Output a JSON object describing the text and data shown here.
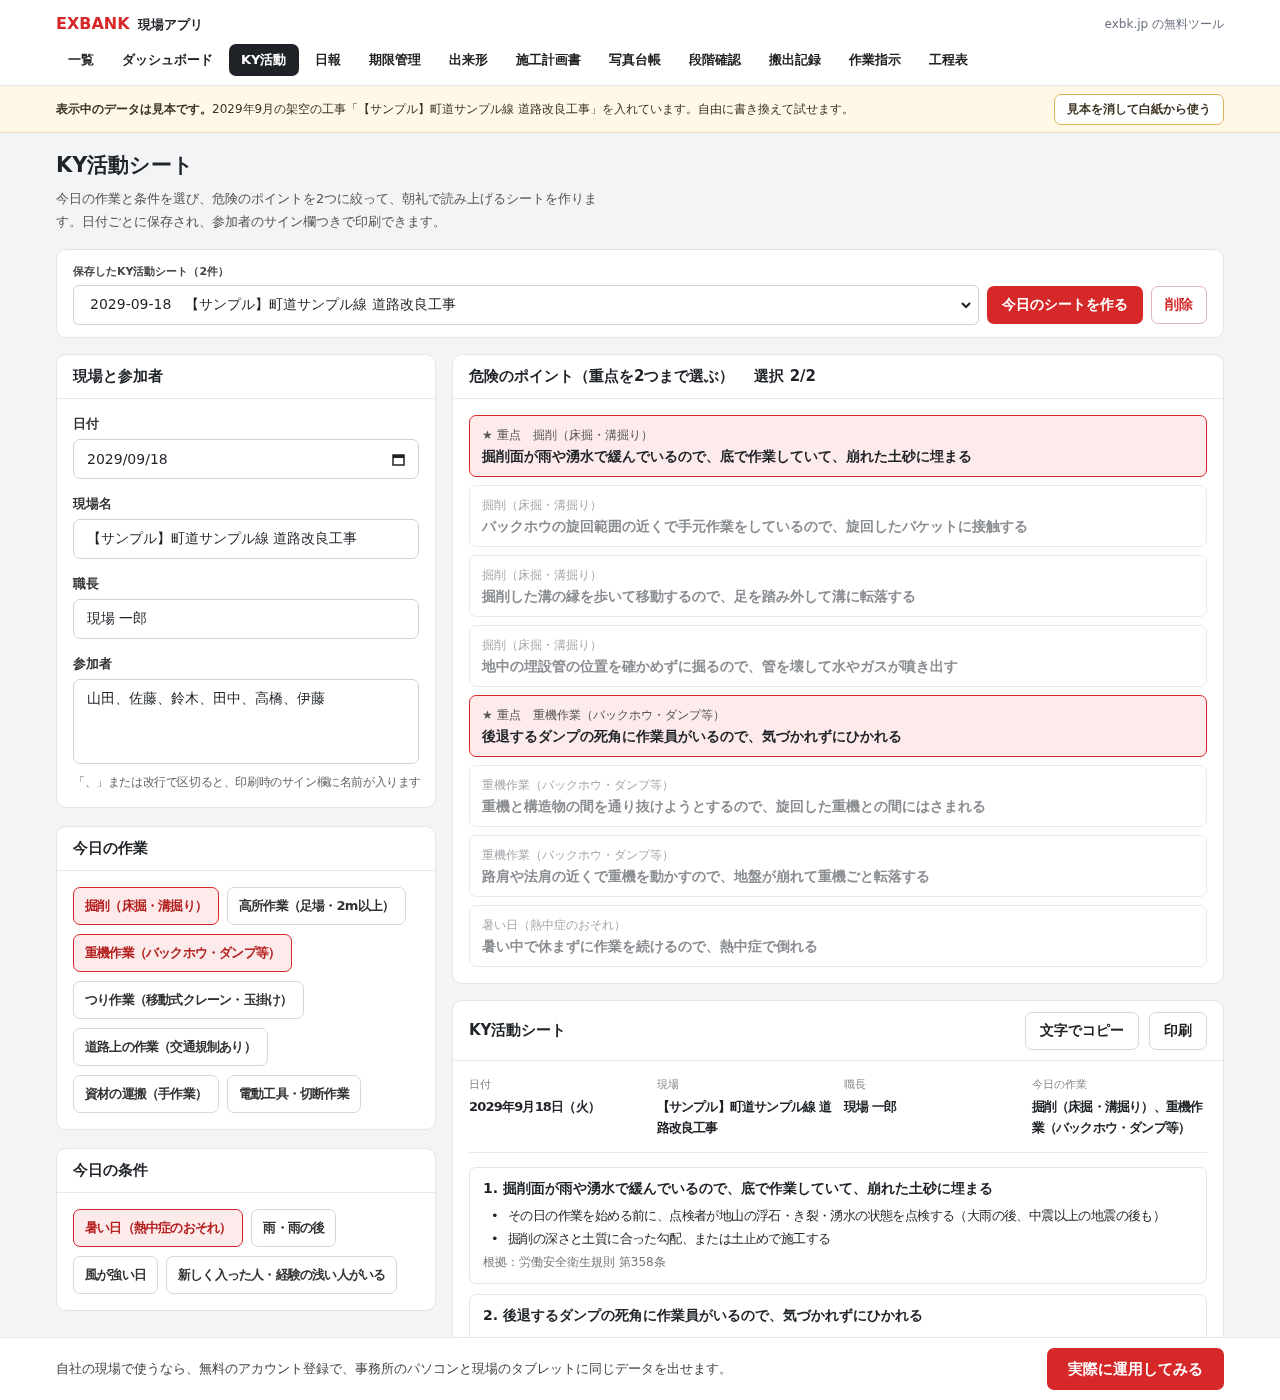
{
  "header": {
    "brand": "EXBANK",
    "app_name": "現場アプリ",
    "tagline": "exbk.jp の無料ツール"
  },
  "nav": [
    {
      "label": "一覧",
      "selected": false
    },
    {
      "label": "ダッシュボード",
      "selected": false
    },
    {
      "label": "KY活動",
      "selected": true
    },
    {
      "label": "日報",
      "selected": false
    },
    {
      "label": "期限管理",
      "selected": false
    },
    {
      "label": "出来形",
      "selected": false
    },
    {
      "label": "施工計画書",
      "selected": false
    },
    {
      "label": "写真台帳",
      "selected": false
    },
    {
      "label": "段階確認",
      "selected": false
    },
    {
      "label": "搬出記録",
      "selected": false
    },
    {
      "label": "作業指示",
      "selected": false
    },
    {
      "label": "工程表",
      "selected": false
    }
  ],
  "notice": {
    "text": "**表示中のデータは見本です。**2029年9月の架空の工事「【サンプル】町道サンプル線 道路改良工事」を入れています。自由に書き換えて試せます。",
    "button": "見本を消して白紙から使う"
  },
  "page": {
    "title": "KY活動シート",
    "description": "今日の作業と条件を選び、危険のポイントを2つに絞って、朝礼で読み上げるシートを作ります。日付ごとに保存され、参加者のサイン欄つきで印刷できます。"
  },
  "saved": {
    "label": "保存したKY活動シート（2件）",
    "selected_value": "2029-09-18　【サンプル】町道サンプル線 道路改良工事",
    "create_button": "今日のシートを作る",
    "delete_button": "削除"
  },
  "site_panel": {
    "title": "現場と参加者",
    "fields": [
      {
        "kind": "date",
        "label": "日付",
        "value": "2029/09/18"
      },
      {
        "kind": "text",
        "label": "現場名",
        "value": "【サンプル】町道サンプル線 道路改良工事"
      },
      {
        "kind": "text",
        "label": "職長",
        "value": "現場 一郎"
      },
      {
        "kind": "textarea",
        "label": "参加者",
        "value": "山田、佐藤、鈴木、田中、高橋、伊藤"
      }
    ],
    "hint": "「、」または改行で区切ると、印刷時のサイン欄に名前が入ります"
  },
  "work": {
    "title": "今日の作業",
    "options": [
      {
        "label": "掘削（床掘・溝掘り）",
        "selected": true
      },
      {
        "label": "高所作業（足場・2m以上）",
        "selected": false
      },
      {
        "label": "重機作業（バックホウ・ダンプ等）",
        "selected": true
      },
      {
        "label": "つり作業（移動式クレーン・玉掛け）",
        "selected": false
      },
      {
        "label": "道路上の作業（交通規制あり）",
        "selected": false
      },
      {
        "label": "資材の運搬（手作業）",
        "selected": false
      },
      {
        "label": "電動工具・切断作業",
        "selected": false
      }
    ]
  },
  "conditions": {
    "title": "今日の条件",
    "options": [
      {
        "label": "暑い日（熱中症のおそれ）",
        "selected": true
      },
      {
        "label": "雨・雨の後",
        "selected": false
      },
      {
        "label": "風が強い日",
        "selected": false
      },
      {
        "label": "新しく入った人・経験の浅い人がいる",
        "selected": false
      }
    ]
  },
  "hazards": {
    "title": "危険のポイント（重点を2つまで選ぶ）",
    "count": "選択 2/2",
    "items": [
      {
        "badge": "★ 重点",
        "category": "掘削（床掘・溝掘り）",
        "text": "掘削面が雨や湧水で緩んでいるので、底で作業していて、崩れた土砂に埋まる",
        "selected": true
      },
      {
        "category": "掘削（床掘・溝掘り）",
        "text": "バックホウの旋回範囲の近くで手元作業をしているので、旋回したバケットに接触する",
        "selected": false
      },
      {
        "category": "掘削（床掘・溝掘り）",
        "text": "掘削した溝の縁を歩いて移動するので、足を踏み外して溝に転落する",
        "selected": false
      },
      {
        "category": "掘削（床掘・溝掘り）",
        "text": "地中の埋設管の位置を確かめずに掘るので、管を壊して水やガスが噴き出す",
        "selected": false
      },
      {
        "badge": "★ 重点",
        "category": "重機作業（バックホウ・ダンプ等）",
        "text": "後退するダンプの死角に作業員がいるので、気づかれずにひかれる",
        "selected": true
      },
      {
        "category": "重機作業（バックホウ・ダンプ等）",
        "text": "重機と構造物の間を通り抜けようとするので、旋回した重機との間にはさまれる",
        "selected": false
      },
      {
        "category": "重機作業（バックホウ・ダンプ等）",
        "text": "路肩や法肩の近くで重機を動かすので、地盤が崩れて重機ごと転落する",
        "selected": false
      },
      {
        "category": "暑い日（熱中症のおそれ）",
        "text": "暑い中で休まずに作業を続けるので、熱中症で倒れる",
        "selected": false
      }
    ]
  },
  "sheet": {
    "title": "KY活動シート",
    "buttons": [
      "文字でコピー",
      "印刷"
    ],
    "bullet": "•",
    "summary": [
      {
        "label": "日付",
        "value": "2029年9月18日（火）"
      },
      {
        "label": "現場",
        "value": "【サンプル】町道サンプル線 道路改良工事"
      },
      {
        "label": "職長",
        "value": "現場 一郎"
      },
      {
        "label": "今日の作業",
        "value": "掘削（床掘・溝掘り）、重機作業（バックホウ・ダンプ等）"
      }
    ],
    "points": [
      {
        "title": "1. 掘削面が雨や湧水で緩んでいるので、底で作業していて、崩れた土砂に埋まる",
        "measures": [
          "その日の作業を始める前に、点検者が地山の浮石・き裂・湧水の状態を点検する（大雨の後、中震以上の地震の後も）",
          "掘削の深さと土質に合った勾配、または土止めで施工する"
        ],
        "basis": "根拠：労働安全衛生規則 第358条"
      },
      {
        "title": "2. 後退するダンプの死角に作業員がいるので、気づかれずにひかれる"
      }
    ]
  },
  "footer": {
    "text": "自社の現場で使うなら、無料のアカウント登録で、事務所のパソコンと現場のタブレットに同じデータを出せます。",
    "button": "実際に運用してみる"
  }
}
